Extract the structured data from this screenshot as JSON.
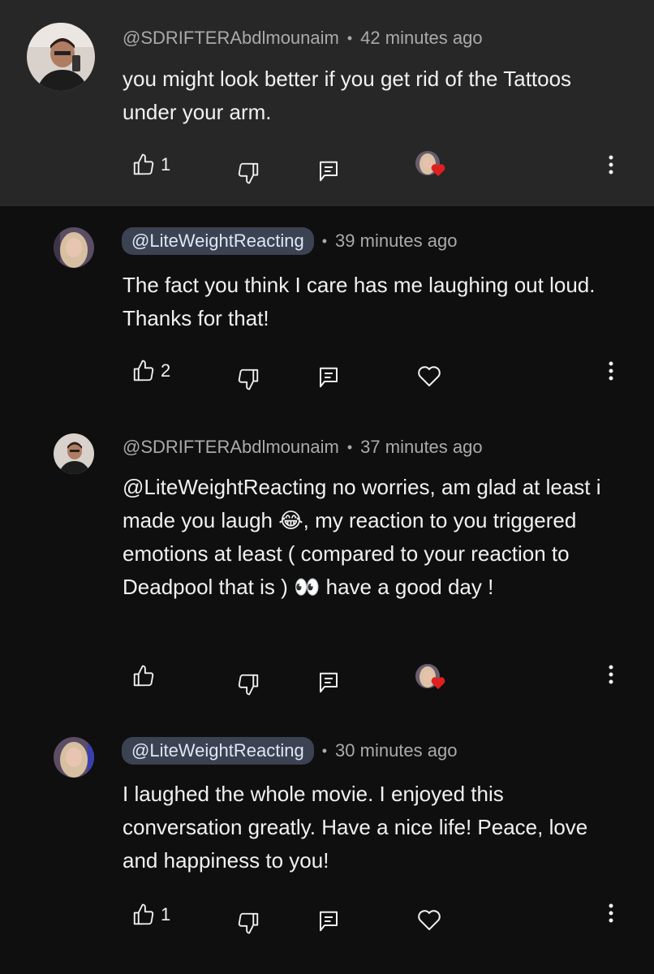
{
  "comments": [
    {
      "author": "@SDRIFTERAbdlmounaim",
      "time": "42 minutes ago",
      "text": "you might look better if you get rid of the Tattoos under your arm.",
      "likes": "1",
      "avatar": "man-selfie-avatar",
      "creator_hearted": true,
      "is_creator": false
    },
    {
      "author": "@LiteWeightReacting",
      "time": "39 minutes ago",
      "text": "The fact you think I care has me laughing out loud. Thanks for that!",
      "likes": "2",
      "avatar": "woman-blonde-avatar",
      "creator_hearted": false,
      "is_creator": true
    },
    {
      "author": "@SDRIFTERAbdlmounaim",
      "time": "37 minutes ago",
      "text": "@LiteWeightReacting no worries, am glad at least i made you laugh 😂, my reaction to you triggered emotions at least ( compared to your reaction to Deadpool that is ) 👀 have a good day !",
      "likes": "",
      "avatar": "man-selfie-avatar",
      "creator_hearted": true,
      "is_creator": false
    },
    {
      "author": "@LiteWeightReacting",
      "time": "30 minutes ago",
      "text": "I laughed the whole movie. I enjoyed this conversation greatly. Have a nice life! Peace, love and happiness to you!",
      "likes": "1",
      "avatar": "woman-blonde-avatar",
      "creator_hearted": false,
      "is_creator": true
    }
  ],
  "separator": "•",
  "icons": {
    "like": "thumbs-up-icon",
    "dislike": "thumbs-down-icon",
    "reply": "reply-icon",
    "heart": "heart-outline-icon",
    "creator_heart": "creator-heart-icon",
    "menu": "more-vertical-icon"
  },
  "colors": {
    "background": "#0f0f0f",
    "highlight": "#272727",
    "chip": "#3b4252",
    "heart": "#e0201f"
  }
}
